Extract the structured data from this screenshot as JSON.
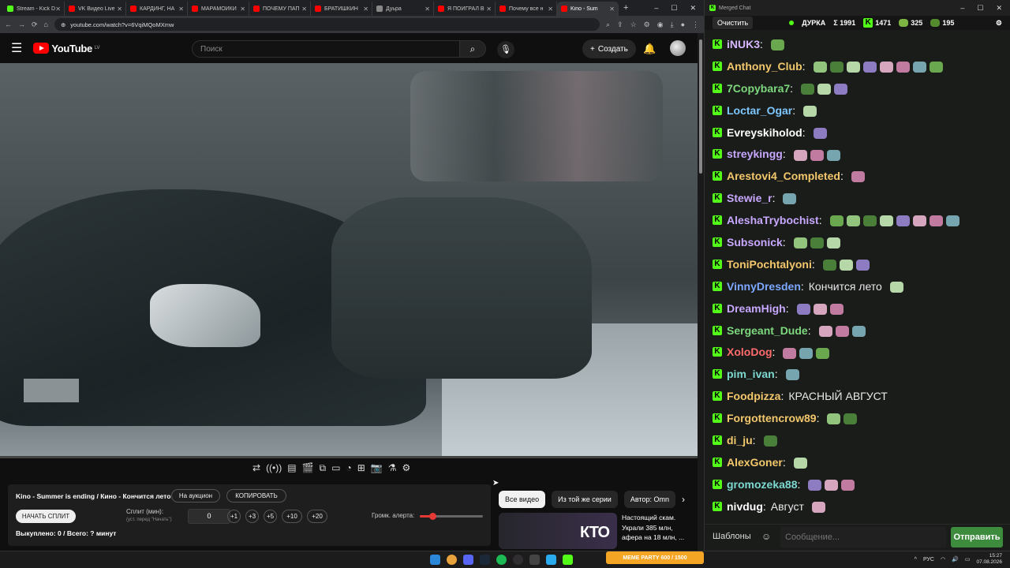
{
  "browser": {
    "tabs": [
      {
        "title": "Stream - Kick D",
        "color": "#53fc18"
      },
      {
        "title": "VK Видео Live",
        "color": "#ff0000"
      },
      {
        "title": "КАРДИНГ, НА",
        "color": "#ff0000"
      },
      {
        "title": "МАРАМОЙКИ",
        "color": "#ff0000"
      },
      {
        "title": "ПОЧЕМУ ПАП",
        "color": "#ff0000"
      },
      {
        "title": "БРАТИШКИН",
        "color": "#ff0000"
      },
      {
        "title": "Дуьра",
        "color": "#888888"
      },
      {
        "title": "Я ПОИГРАЛ В",
        "color": "#ff0000"
      },
      {
        "title": "Почему все н",
        "color": "#ff0000"
      },
      {
        "title": "Kino - Sum",
        "color": "#ff0000"
      }
    ],
    "active_tab": 9,
    "url": "youtube.com/watch?v=6VqiMQoMXmw"
  },
  "youtube": {
    "logo": "YouTube",
    "region": "LV",
    "search_placeholder": "Поиск",
    "create_label": "Создать"
  },
  "auction": {
    "lot_title": "Kino - Summer is ending / Кино - Кончится лето",
    "auction_btn": "На аукцион",
    "copy_btn": "КОПИРОВАТЬ",
    "split_btn": "НАЧАТЬ СПЛИТ",
    "split_label": "Сплит (мин):",
    "split_hint": "(уст. перед \"Начать\")",
    "split_value": "0",
    "increments": [
      "+1",
      "+3",
      "+5",
      "+10",
      "+20"
    ],
    "alert_label": "Громк. алерта:",
    "alert_level": 0.2,
    "bought": "Выкуплено: 0 / Всего: ? минут"
  },
  "related": {
    "chips": [
      "Все видео",
      "Из той же серии",
      "Автор: Omn"
    ],
    "thumb_text": "КТО",
    "title": "Настоящий скам. Украли 385 млн, афера на 18 млн, ..."
  },
  "chat": {
    "window_title": "Merged Chat",
    "clear": "Очистить",
    "channel": "ДУРКА",
    "total": "Σ 1991",
    "kick_count": "1471",
    "count2": "325",
    "count3": "195",
    "messages": [
      {
        "user": "iNUK3",
        "color": "#d7b8ff",
        "text": "",
        "emotes": 1
      },
      {
        "user": "Anthony_Club",
        "color": "#f3c76b",
        "text": "",
        "emotes": 8
      },
      {
        "user": "7Copybara7",
        "color": "#7dd87d",
        "text": "",
        "emotes": 3
      },
      {
        "user": "Loctar_Ogar",
        "color": "#7dc7ff",
        "text": "",
        "emotes": 1
      },
      {
        "user": "Evreyskiholod",
        "color": "#ffffff",
        "text": "",
        "emotes": 1
      },
      {
        "user": "streykingg",
        "color": "#c8a8ff",
        "text": "",
        "emotes": 3
      },
      {
        "user": "Arestovi4_Completed",
        "color": "#f3c76b",
        "text": "",
        "emotes": 1
      },
      {
        "user": "Stewie_r",
        "color": "#c8a8ff",
        "text": "",
        "emotes": 1
      },
      {
        "user": "AleshaTrybochist",
        "color": "#c8a8ff",
        "text": "",
        "emotes": 8
      },
      {
        "user": "Subsonick",
        "color": "#c8a8ff",
        "text": "",
        "emotes": 3
      },
      {
        "user": "ToniPochtalyoni",
        "color": "#f3c76b",
        "text": "",
        "emotes": 3
      },
      {
        "user": "VinnyDresden",
        "color": "#7da8ff",
        "text": "Кончится лето",
        "emotes": 1
      },
      {
        "user": "DreamHigh",
        "color": "#c8a8ff",
        "text": "",
        "emotes": 3
      },
      {
        "user": "Sergeant_Dude",
        "color": "#7dd87d",
        "text": "",
        "emotes": 3
      },
      {
        "user": "XoloDog",
        "color": "#ff6b6b",
        "text": "",
        "emotes": 3
      },
      {
        "user": "pim_ivan",
        "color": "#7dd8d0",
        "text": "",
        "emotes": 1
      },
      {
        "user": "Foodpizza",
        "color": "#f3c76b",
        "text": "КРАСНЫЙ АВГУСТ",
        "emotes": 0
      },
      {
        "user": "Forgottencrow89",
        "color": "#f3c76b",
        "text": "",
        "emotes": 2
      },
      {
        "user": "di_ju",
        "color": "#f3c76b",
        "text": "",
        "emotes": 1
      },
      {
        "user": "AlexGoner",
        "color": "#f3c76b",
        "text": "",
        "emotes": 1
      },
      {
        "user": "gromozeka88",
        "color": "#7dd8d0",
        "text": "",
        "emotes": 3
      },
      {
        "user": "nivdug",
        "color": "#ffffff",
        "text": "Август",
        "emotes": 1
      }
    ],
    "templates": "Шаблоны",
    "placeholder": "Сообщение...",
    "send": "Отправить"
  },
  "taskbar": {
    "widget": "MEME PARTY",
    "widget_progress": "600 / 1500",
    "lang": "РУС",
    "time": "15:27",
    "date": "07.08.2026"
  },
  "colors": {
    "kick": "#53fc18",
    "youtube_red": "#ff0000",
    "send_green": "#3d8b3d"
  }
}
